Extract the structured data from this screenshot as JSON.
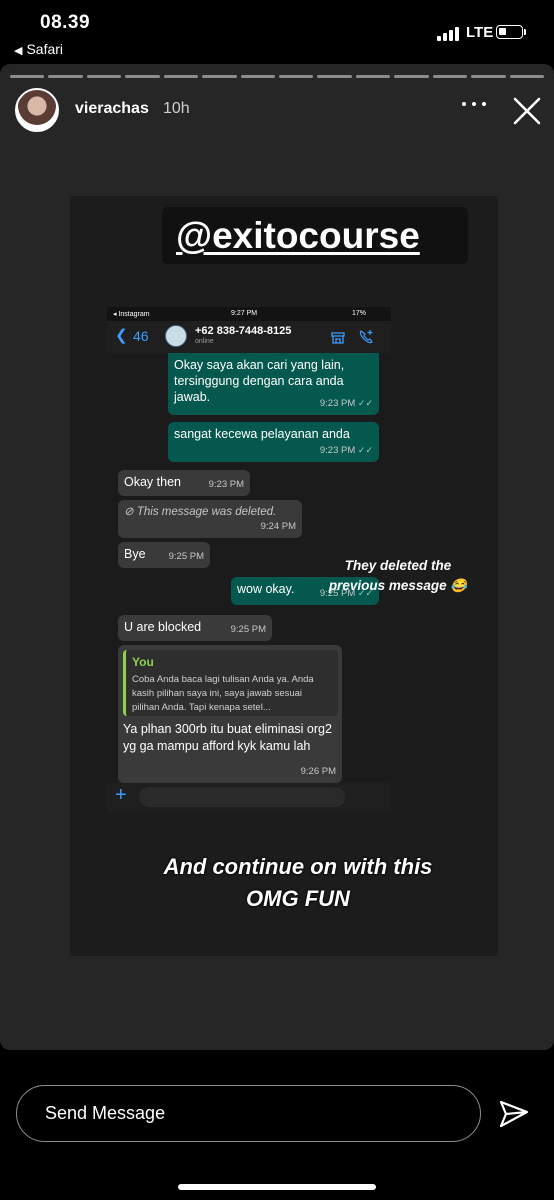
{
  "status": {
    "time": "08.39",
    "back_app": "Safari",
    "network": "LTE"
  },
  "story": {
    "username": "vierachas",
    "time_ago": "10h",
    "tag": "@exitocourse",
    "caption_side": "They deleted the previous message 😂",
    "caption_main": "And continue on with this OMG FUN",
    "progress_segments": 14
  },
  "chat_screenshot": {
    "status": {
      "app": "◂ Instagram",
      "time": "9:27 PM",
      "battery": "17%"
    },
    "header": {
      "back_count": "46",
      "contact": "+62 838-7448-8125",
      "presence": "online"
    },
    "messages": [
      {
        "dir": "out",
        "text": "Okay saya akan cari yang lain, tersinggung dengan cara anda jawab.",
        "time": "9:23 PM"
      },
      {
        "dir": "out",
        "text": "sangat kecewa pelayanan anda",
        "time": "9:23 PM"
      },
      {
        "dir": "in",
        "text": "Okay then",
        "time": "9:23 PM"
      },
      {
        "dir": "in",
        "text": "This message was deleted.",
        "time": "9:24 PM",
        "deleted": true
      },
      {
        "dir": "in",
        "text": "Bye",
        "time": "9:25 PM"
      },
      {
        "dir": "out",
        "text": "wow okay.",
        "time": "9:25 PM"
      },
      {
        "dir": "in",
        "text": "U are blocked",
        "time": "9:25 PM"
      },
      {
        "dir": "in",
        "quote_author": "You",
        "quote_text": "Coba Anda baca lagi tulisan Anda ya. Anda kasih pilihan saya ini, saya jawab sesuai pilihan Anda. Tapi kenapa setel...",
        "text": "Ya plhan 300rb itu buat eliminasi org2 yg ga mampu afford kyk kamu lah",
        "time": "9:26 PM"
      }
    ]
  },
  "composer": {
    "placeholder": "Send Message"
  },
  "colors": {
    "story_bg": "#262626",
    "outgoing_bubble": "#05584e",
    "incoming_bubble": "#3a3a3a",
    "link_blue": "#3e9cff"
  }
}
